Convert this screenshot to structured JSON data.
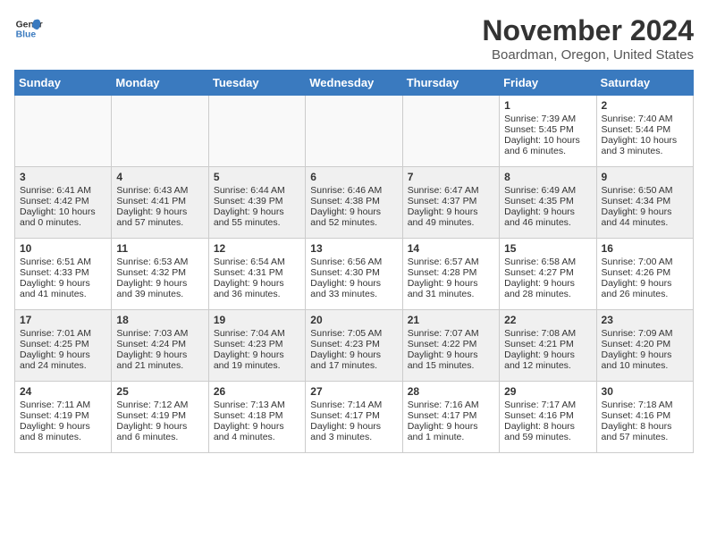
{
  "header": {
    "logo_line1": "General",
    "logo_line2": "Blue",
    "title": "November 2024",
    "subtitle": "Boardman, Oregon, United States"
  },
  "weekdays": [
    "Sunday",
    "Monday",
    "Tuesday",
    "Wednesday",
    "Thursday",
    "Friday",
    "Saturday"
  ],
  "rows": [
    [
      {
        "day": "",
        "text": ""
      },
      {
        "day": "",
        "text": ""
      },
      {
        "day": "",
        "text": ""
      },
      {
        "day": "",
        "text": ""
      },
      {
        "day": "",
        "text": ""
      },
      {
        "day": "1",
        "text": "Sunrise: 7:39 AM\nSunset: 5:45 PM\nDaylight: 10 hours and 6 minutes."
      },
      {
        "day": "2",
        "text": "Sunrise: 7:40 AM\nSunset: 5:44 PM\nDaylight: 10 hours and 3 minutes."
      }
    ],
    [
      {
        "day": "3",
        "text": "Sunrise: 6:41 AM\nSunset: 4:42 PM\nDaylight: 10 hours and 0 minutes."
      },
      {
        "day": "4",
        "text": "Sunrise: 6:43 AM\nSunset: 4:41 PM\nDaylight: 9 hours and 57 minutes."
      },
      {
        "day": "5",
        "text": "Sunrise: 6:44 AM\nSunset: 4:39 PM\nDaylight: 9 hours and 55 minutes."
      },
      {
        "day": "6",
        "text": "Sunrise: 6:46 AM\nSunset: 4:38 PM\nDaylight: 9 hours and 52 minutes."
      },
      {
        "day": "7",
        "text": "Sunrise: 6:47 AM\nSunset: 4:37 PM\nDaylight: 9 hours and 49 minutes."
      },
      {
        "day": "8",
        "text": "Sunrise: 6:49 AM\nSunset: 4:35 PM\nDaylight: 9 hours and 46 minutes."
      },
      {
        "day": "9",
        "text": "Sunrise: 6:50 AM\nSunset: 4:34 PM\nDaylight: 9 hours and 44 minutes."
      }
    ],
    [
      {
        "day": "10",
        "text": "Sunrise: 6:51 AM\nSunset: 4:33 PM\nDaylight: 9 hours and 41 minutes."
      },
      {
        "day": "11",
        "text": "Sunrise: 6:53 AM\nSunset: 4:32 PM\nDaylight: 9 hours and 39 minutes."
      },
      {
        "day": "12",
        "text": "Sunrise: 6:54 AM\nSunset: 4:31 PM\nDaylight: 9 hours and 36 minutes."
      },
      {
        "day": "13",
        "text": "Sunrise: 6:56 AM\nSunset: 4:30 PM\nDaylight: 9 hours and 33 minutes."
      },
      {
        "day": "14",
        "text": "Sunrise: 6:57 AM\nSunset: 4:28 PM\nDaylight: 9 hours and 31 minutes."
      },
      {
        "day": "15",
        "text": "Sunrise: 6:58 AM\nSunset: 4:27 PM\nDaylight: 9 hours and 28 minutes."
      },
      {
        "day": "16",
        "text": "Sunrise: 7:00 AM\nSunset: 4:26 PM\nDaylight: 9 hours and 26 minutes."
      }
    ],
    [
      {
        "day": "17",
        "text": "Sunrise: 7:01 AM\nSunset: 4:25 PM\nDaylight: 9 hours and 24 minutes."
      },
      {
        "day": "18",
        "text": "Sunrise: 7:03 AM\nSunset: 4:24 PM\nDaylight: 9 hours and 21 minutes."
      },
      {
        "day": "19",
        "text": "Sunrise: 7:04 AM\nSunset: 4:23 PM\nDaylight: 9 hours and 19 minutes."
      },
      {
        "day": "20",
        "text": "Sunrise: 7:05 AM\nSunset: 4:23 PM\nDaylight: 9 hours and 17 minutes."
      },
      {
        "day": "21",
        "text": "Sunrise: 7:07 AM\nSunset: 4:22 PM\nDaylight: 9 hours and 15 minutes."
      },
      {
        "day": "22",
        "text": "Sunrise: 7:08 AM\nSunset: 4:21 PM\nDaylight: 9 hours and 12 minutes."
      },
      {
        "day": "23",
        "text": "Sunrise: 7:09 AM\nSunset: 4:20 PM\nDaylight: 9 hours and 10 minutes."
      }
    ],
    [
      {
        "day": "24",
        "text": "Sunrise: 7:11 AM\nSunset: 4:19 PM\nDaylight: 9 hours and 8 minutes."
      },
      {
        "day": "25",
        "text": "Sunrise: 7:12 AM\nSunset: 4:19 PM\nDaylight: 9 hours and 6 minutes."
      },
      {
        "day": "26",
        "text": "Sunrise: 7:13 AM\nSunset: 4:18 PM\nDaylight: 9 hours and 4 minutes."
      },
      {
        "day": "27",
        "text": "Sunrise: 7:14 AM\nSunset: 4:17 PM\nDaylight: 9 hours and 3 minutes."
      },
      {
        "day": "28",
        "text": "Sunrise: 7:16 AM\nSunset: 4:17 PM\nDaylight: 9 hours and 1 minute."
      },
      {
        "day": "29",
        "text": "Sunrise: 7:17 AM\nSunset: 4:16 PM\nDaylight: 8 hours and 59 minutes."
      },
      {
        "day": "30",
        "text": "Sunrise: 7:18 AM\nSunset: 4:16 PM\nDaylight: 8 hours and 57 minutes."
      }
    ]
  ]
}
